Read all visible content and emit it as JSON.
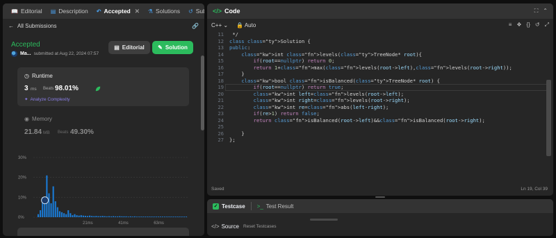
{
  "tabs": [
    {
      "label": "Editorial",
      "icon": "book-icon"
    },
    {
      "label": "Description",
      "icon": "document-icon"
    },
    {
      "label": "Accepted",
      "icon": "accepted-icon"
    },
    {
      "label": "Solutions",
      "icon": "flask-icon"
    },
    {
      "label": "Submiss",
      "icon": "history-icon"
    }
  ],
  "submissions": {
    "back_label": "All Submissions"
  },
  "result": {
    "status": "Accepted",
    "user": "Ma...",
    "submitted_text": "submitted at Aug 22, 2024 07:57",
    "editorial_label": "Editorial",
    "solution_label": "Solution"
  },
  "runtime": {
    "title": "Runtime",
    "value": "3",
    "unit": "ms",
    "beats_label": "Beats",
    "beats_pct": "98.01%",
    "analyze_label": "Analyze Complexity"
  },
  "memory": {
    "title": "Memory",
    "value": "21.84",
    "unit": "MB",
    "beats_label": "Beats",
    "beats_pct": "49.30%"
  },
  "chart_data": {
    "type": "bar",
    "y_ticks": [
      "30%",
      "20%",
      "10%",
      "0%"
    ],
    "x_ticks": [
      "21ms",
      "41ms",
      "63ms"
    ],
    "ylim": [
      0,
      30
    ],
    "highlight_index": 1,
    "values": [
      1.5,
      3.5,
      10,
      8.5,
      21,
      12,
      7,
      15.5,
      8,
      5,
      3,
      2.5,
      2,
      1.5,
      3.5,
      2,
      1,
      1.5,
      1,
      0.8,
      1,
      0.8,
      0.7,
      0.6,
      0.8,
      0.6,
      0.5,
      0.6,
      0.5,
      0.5,
      0.6,
      0.5,
      0.4,
      0.5,
      0.4,
      0.5,
      0.4,
      0.4,
      0.5,
      0.4,
      0.4,
      0.4,
      0.3,
      0.4,
      0.3,
      0.4,
      0.3,
      0.3,
      0.3,
      0.3,
      0.3,
      0.3,
      0.3,
      0.3,
      0.3,
      0.3,
      0.3,
      0.3,
      0.3,
      0.3,
      0.3,
      0.3,
      0.3,
      0.3,
      0.3,
      0.3,
      0.3,
      0.3,
      0.3,
      0.3
    ]
  },
  "code": {
    "title": "Code",
    "language": "C++",
    "mode": "Auto",
    "status": "Saved",
    "cursor": "Ln 19, Col 39"
  },
  "code_lines": [
    {
      "n": "11",
      "t": " */"
    },
    {
      "n": "12",
      "t": "class Solution {"
    },
    {
      "n": "13",
      "t": "public:"
    },
    {
      "n": "14",
      "t": "    int levels(TreeNode* root){"
    },
    {
      "n": "15",
      "t": "        if(root==nullptr) return 0;"
    },
    {
      "n": "16",
      "t": "        return 1+max(levels(root->left),levels(root->right));"
    },
    {
      "n": "17",
      "t": "    }"
    },
    {
      "n": "18",
      "t": "    bool isBalanced(TreeNode* root) {"
    },
    {
      "n": "19",
      "t": "        if(root==nullptr) return true;"
    },
    {
      "n": "20",
      "t": "        int left=levels(root->left);"
    },
    {
      "n": "21",
      "t": "        int right=levels(root->right);"
    },
    {
      "n": "22",
      "t": "        int re=abs(left-right);"
    },
    {
      "n": "23",
      "t": "        if(re>1) return false;"
    },
    {
      "n": "24",
      "t": "        return isBalanced(root->left)&&isBalanced(root->right);"
    },
    {
      "n": "25",
      "t": ""
    },
    {
      "n": "26",
      "t": "    }"
    },
    {
      "n": "27",
      "t": "};"
    }
  ],
  "bottom": {
    "testcase_label": "Testcase",
    "test_result_label": "Test Result",
    "source_label": "Source",
    "reset_label": "Reset Testcases"
  },
  "colors": {
    "accent": "#2cbb5d",
    "analyze": "#8b7fe8",
    "bar": "#1a7bd6",
    "bg": "#0f0f0f",
    "panel": "#262626"
  }
}
